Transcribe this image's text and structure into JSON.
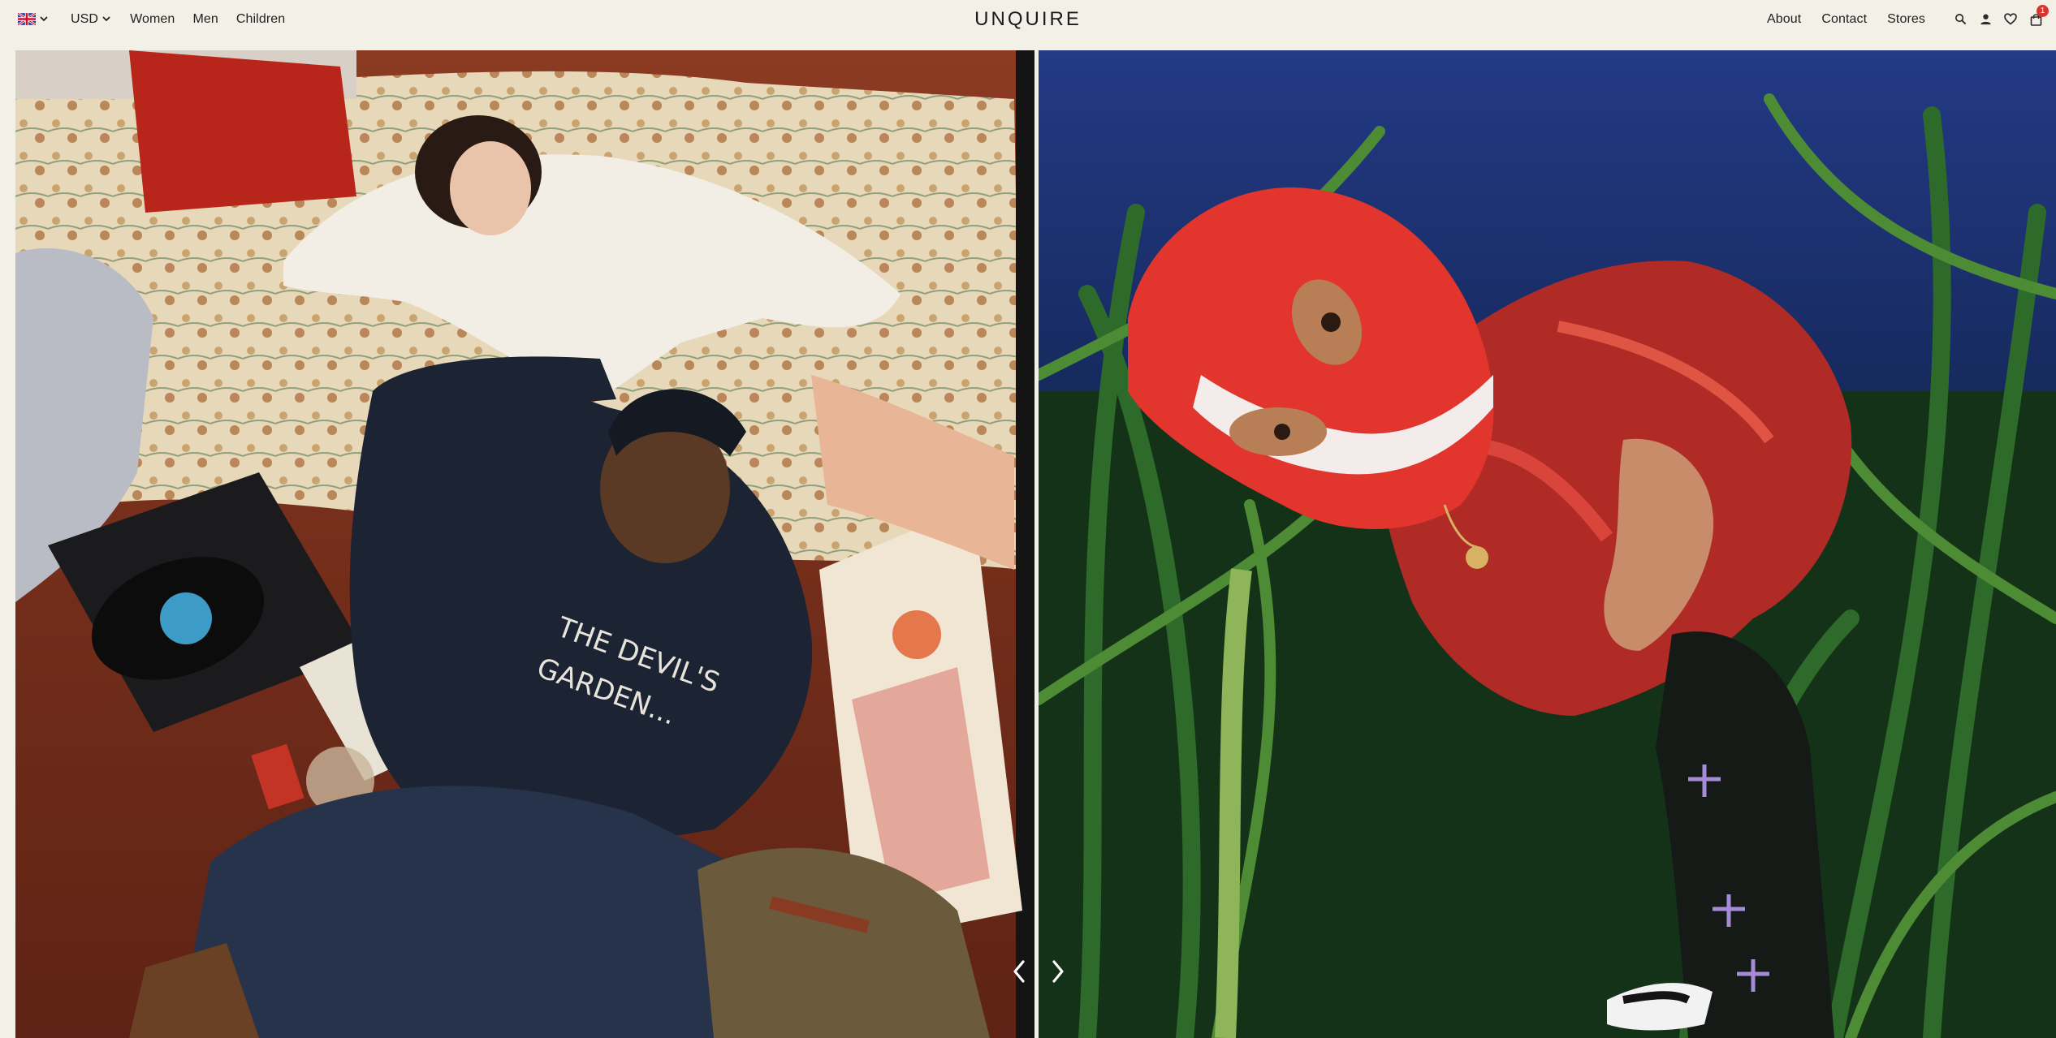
{
  "header": {
    "locale_flag": "uk-flag-icon",
    "currency": "USD",
    "nav_left": [
      "Women",
      "Men",
      "Children"
    ],
    "logo": "UNQUIRE",
    "nav_right": [
      "About",
      "Contact",
      "Stores"
    ],
    "cart_count": "1"
  },
  "hero": {
    "slides": [
      {
        "subject": "couple-lounging-photo"
      },
      {
        "subject": "red-balaclava-cornfield-photo"
      }
    ],
    "prev_icon": "chevron-left-icon",
    "next_icon": "chevron-right-icon"
  },
  "colors": {
    "background": "#f3f0e8",
    "text": "#1f1f1f",
    "badge": "#d6362f"
  }
}
